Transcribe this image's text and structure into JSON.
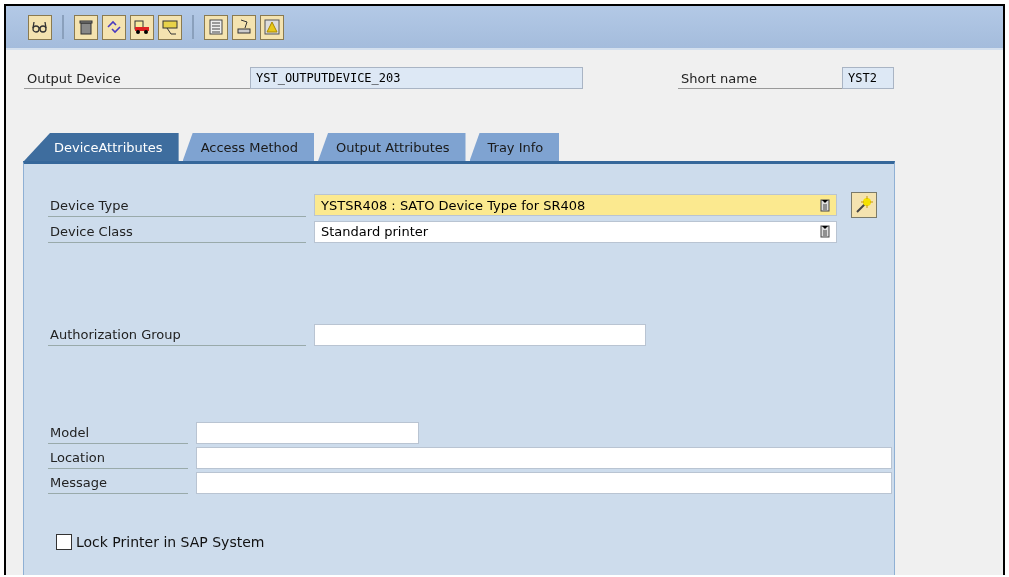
{
  "header_fields": [
    {
      "label": "Output Device",
      "value": "YST_OUTPUTDEVICE_203"
    },
    {
      "label": "Short name",
      "value": "YST2"
    }
  ],
  "tabs": [
    {
      "label": "DeviceAttributes",
      "selected": true
    },
    {
      "label": "Access Method",
      "selected": false
    },
    {
      "label": "Output Attributes",
      "selected": false
    },
    {
      "label": "Tray Info",
      "selected": false
    }
  ],
  "field_groups": [
    [
      {
        "label": "Device Type",
        "value": "YSTSR408 : SATO Device Type for SR408",
        "kind": "dropdown",
        "focused": true,
        "wizard": true
      },
      {
        "label": "Device Class",
        "value": "Standard printer",
        "kind": "dropdown",
        "focused": false,
        "wizard": false
      }
    ],
    [
      {
        "label": "Authorization Group",
        "kind": "text",
        "focused": false,
        "wizard": false
      }
    ],
    [
      {
        "label": "Model",
        "kind": "short",
        "focused": false,
        "wizard": false
      },
      {
        "label": "Location",
        "kind": "long",
        "focused": false,
        "wizard": false
      },
      {
        "label": "Message",
        "kind": "long",
        "focused": false,
        "wizard": false
      }
    ]
  ],
  "checkbox": {
    "label": "Lock Printer in SAP System",
    "checked": false
  }
}
